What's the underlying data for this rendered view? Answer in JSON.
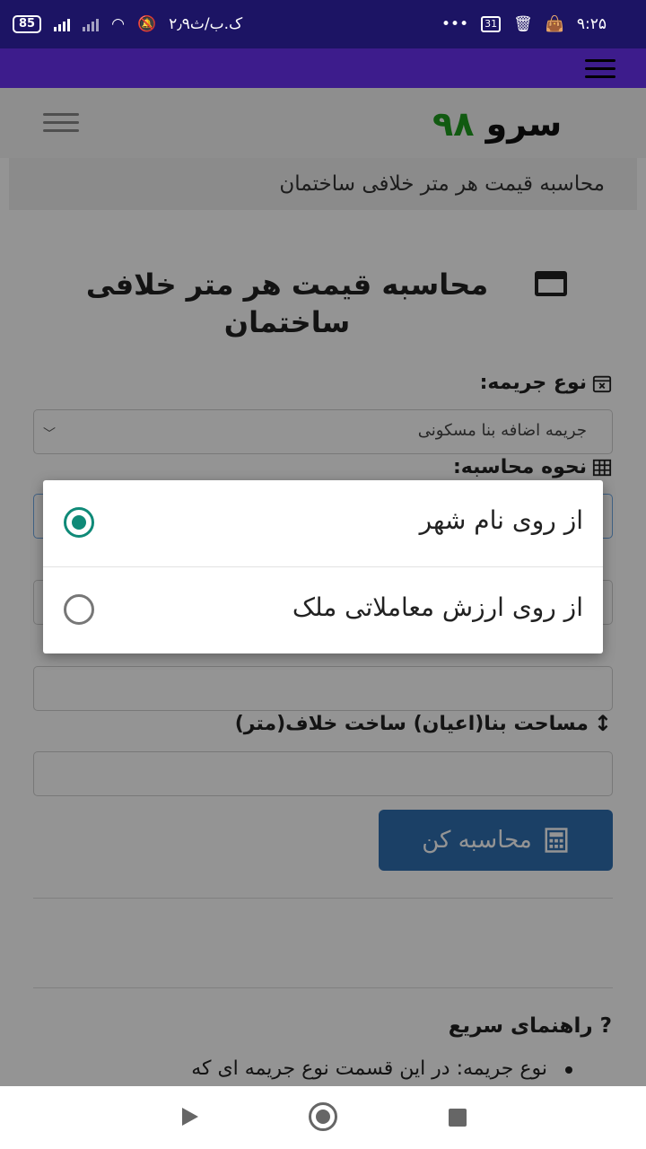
{
  "status_bar": {
    "battery": "85",
    "speed": "۲٫۹ک.ب/ث",
    "notif_dots": "•••",
    "calendar_day": "31",
    "time": "۹:۲۵"
  },
  "header": {
    "logo_word": "سرو",
    "logo_number": "۹۸"
  },
  "breadcrumb": "محاسبه قیمت هر متر خلافی ساختمان",
  "page_title": "محاسبه قیمت هر متر خلافی ساختمان",
  "form": {
    "penalty_type_label": "نوع جریمه:",
    "penalty_type_value": "جریمه اضافه بنا مسکونی",
    "calc_method_label": "نحوه محاسبه:",
    "area_label": "مساحت بنا(اعیان) ساخت خلاف(متر)",
    "calc_button": "محاسبه کن"
  },
  "guide": {
    "title": "راهنمای سریع",
    "title_icon": "?",
    "item_1": "نوع جریمه: در این قسمت نوع جریمه ای که"
  },
  "dialog": {
    "options": [
      {
        "label": "از روی نام شهر",
        "selected": true
      },
      {
        "label": "از روی ارزش معاملاتی ملک",
        "selected": false
      }
    ]
  },
  "colors": {
    "status_bar": "#1c1464",
    "app_bar": "#3d1c8c",
    "radio_selected": "#0f8a78",
    "button": "#2f6fb0",
    "logo_number": "#1e9b1e"
  }
}
